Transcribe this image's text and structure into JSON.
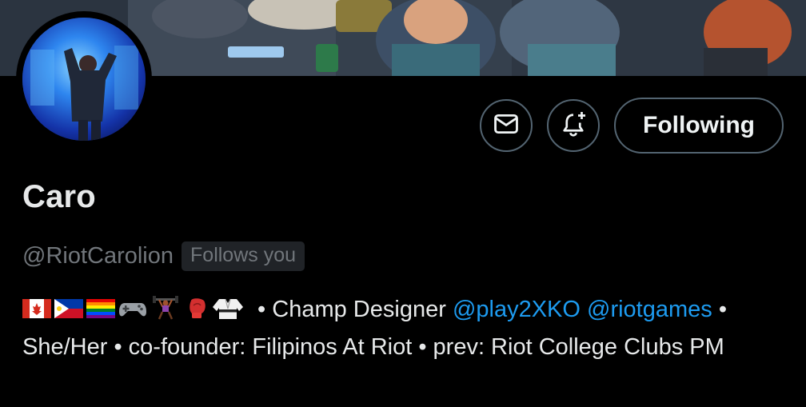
{
  "profile": {
    "display_name": "Caro",
    "handle": "@RiotCarolion",
    "follows_you_badge": "Follows you"
  },
  "actions": {
    "message_icon": "envelope-icon",
    "notify_icon": "bell-plus-icon",
    "follow_label": "Following"
  },
  "bio": {
    "emoji_icons": [
      "canada-flag-icon",
      "philippines-flag-icon",
      "rainbow-flag-icon",
      "game-controller-icon",
      "weightlifter-icon",
      "boxing-glove-icon",
      "martial-arts-uniform-icon"
    ],
    "part1": " • Champ Designer ",
    "mention1": "@play2XKO",
    "space": " ",
    "mention2": "@riotgames",
    "part2": " • She/Her • co-founder: Filipinos At Riot • prev: Riot College Clubs PM"
  },
  "colors": {
    "background": "#000000",
    "text": "#e7e9ea",
    "muted": "#71767b",
    "link": "#1d9bf0",
    "border": "#536471"
  }
}
